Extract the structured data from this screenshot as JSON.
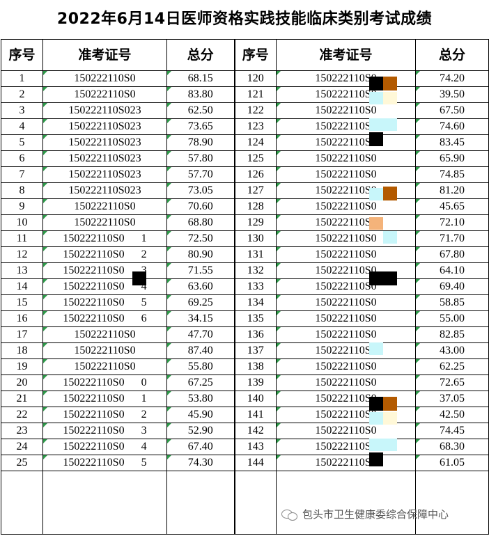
{
  "title": "2022年6月14日医师资格实践技能临床类别考试成绩",
  "headers": [
    "序号",
    "准考证号",
    "总分",
    "序号",
    "准考证号",
    "总分"
  ],
  "rows": [
    {
      "seq_l": "1",
      "id_l": "150222110S0",
      "score_l": "68.15",
      "seq_r": "120",
      "id_r": "150222110S0",
      "score_r": "74.20"
    },
    {
      "seq_l": "2",
      "id_l": "150222110S0",
      "score_l": "83.80",
      "seq_r": "121",
      "id_r": "150222110S0",
      "score_r": "39.50"
    },
    {
      "seq_l": "3",
      "id_l": "150222110S023",
      "score_l": "62.50",
      "seq_r": "122",
      "id_r": "150222110S0",
      "score_r": "67.50"
    },
    {
      "seq_l": "4",
      "id_l": "150222110S023",
      "score_l": "73.65",
      "seq_r": "123",
      "id_r": "150222110S0",
      "score_r": "74.60"
    },
    {
      "seq_l": "5",
      "id_l": "150222110S023",
      "score_l": "78.90",
      "seq_r": "124",
      "id_r": "150222110S0",
      "score_r": "83.45"
    },
    {
      "seq_l": "6",
      "id_l": "150222110S023",
      "score_l": "57.80",
      "seq_r": "125",
      "id_r": "150222110S0",
      "score_r": "65.90"
    },
    {
      "seq_l": "7",
      "id_l": "150222110S023",
      "score_l": "57.70",
      "seq_r": "126",
      "id_r": "150222110S0",
      "score_r": "74.85"
    },
    {
      "seq_l": "8",
      "id_l": "150222110S023",
      "score_l": "73.05",
      "seq_r": "127",
      "id_r": "150222110S0",
      "score_r": "81.20"
    },
    {
      "seq_l": "9",
      "id_l": "150222110S0",
      "score_l": "70.60",
      "seq_r": "128",
      "id_r": "150222110S0",
      "score_r": "45.65"
    },
    {
      "seq_l": "10",
      "id_l": "150222110S0",
      "score_l": "68.80",
      "seq_r": "129",
      "id_r": "150222110S0",
      "score_r": "72.10"
    },
    {
      "seq_l": "11",
      "id_l": "150222110S0      1",
      "score_l": "72.50",
      "seq_r": "130",
      "id_r": "150222110S0",
      "score_r": "71.70"
    },
    {
      "seq_l": "12",
      "id_l": "150222110S0      2",
      "score_l": "80.90",
      "seq_r": "131",
      "id_r": "150222110S0",
      "score_r": "67.80"
    },
    {
      "seq_l": "13",
      "id_l": "150222110S0      3",
      "score_l": "71.55",
      "seq_r": "132",
      "id_r": "150222110S0",
      "score_r": "64.10"
    },
    {
      "seq_l": "14",
      "id_l": "150222110S0      4",
      "score_l": "63.60",
      "seq_r": "133",
      "id_r": "150222110S0",
      "score_r": "69.40"
    },
    {
      "seq_l": "15",
      "id_l": "150222110S0      5",
      "score_l": "69.25",
      "seq_r": "134",
      "id_r": "150222110S0",
      "score_r": "58.85"
    },
    {
      "seq_l": "16",
      "id_l": "150222110S0      6",
      "score_l": "34.15",
      "seq_r": "135",
      "id_r": "150222110S0",
      "score_r": "55.00"
    },
    {
      "seq_l": "17",
      "id_l": "150222110S0",
      "score_l": "47.70",
      "seq_r": "136",
      "id_r": "150222110S0",
      "score_r": "82.85"
    },
    {
      "seq_l": "18",
      "id_l": "150222110S0",
      "score_l": "87.40",
      "seq_r": "137",
      "id_r": "150222110S0",
      "score_r": "43.00"
    },
    {
      "seq_l": "19",
      "id_l": "150222110S0",
      "score_l": "55.80",
      "seq_r": "138",
      "id_r": "150222110S0",
      "score_r": "62.25"
    },
    {
      "seq_l": "20",
      "id_l": "150222110S0      0",
      "score_l": "67.25",
      "seq_r": "139",
      "id_r": "150222110S0",
      "score_r": "72.65"
    },
    {
      "seq_l": "21",
      "id_l": "150222110S0      1",
      "score_l": "53.80",
      "seq_r": "140",
      "id_r": "150222110S0",
      "score_r": "37.05"
    },
    {
      "seq_l": "22",
      "id_l": "150222110S0      2",
      "score_l": "45.90",
      "seq_r": "141",
      "id_r": "150222110S0",
      "score_r": "42.50"
    },
    {
      "seq_l": "23",
      "id_l": "150222110S0      3",
      "score_l": "52.90",
      "seq_r": "142",
      "id_r": "150222110S0",
      "score_r": "74.45"
    },
    {
      "seq_l": "24",
      "id_l": "150222110S0      4",
      "score_l": "67.40",
      "seq_r": "143",
      "id_r": "150222110S0",
      "score_r": "68.30"
    },
    {
      "seq_l": "25",
      "id_l": "150222110S0      5",
      "score_l": "74.30",
      "seq_r": "144",
      "id_r": "150222110S0",
      "score_r": "61.05"
    }
  ],
  "watermark": {
    "text": "包头市卫生健康委综合保障中心",
    "icon": "wechat-icon"
  },
  "colors": {
    "tick": "#2e9a4a",
    "mask_black": "#000000",
    "mask_brown": "#b35a00",
    "mask_cyan": "#c8f6fa",
    "mask_orange": "#f4b37a",
    "mask_cream": "#fff8d8"
  }
}
